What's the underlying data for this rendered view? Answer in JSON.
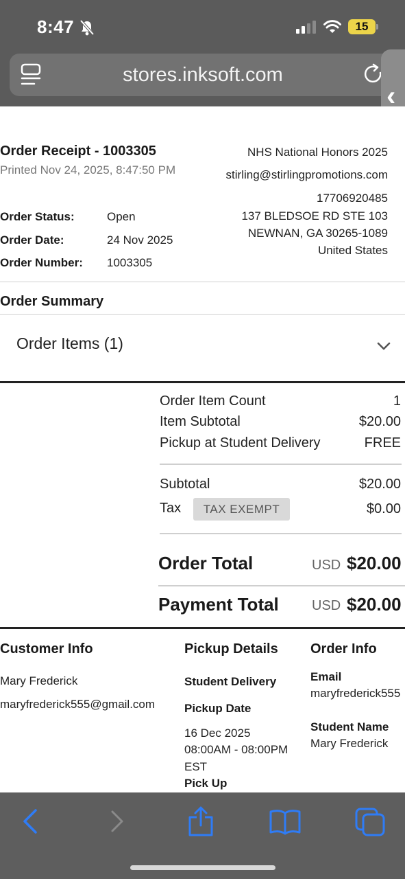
{
  "status_bar": {
    "time": "8:47",
    "battery": "15"
  },
  "browser": {
    "url": "stores.inksoft.com"
  },
  "receipt": {
    "title": "Order Receipt - 1003305",
    "printed": "Printed Nov 24, 2025, 8:47:50 PM",
    "store": {
      "name": "NHS National Honors 2025",
      "email": "stirling@stirlingpromotions.com",
      "phone": "17706920485",
      "address1": "137 BLEDSOE RD STE 103",
      "address2": "NEWNAN, GA 30265-1089",
      "country": "United States"
    },
    "fields": [
      {
        "label": "Order Status:",
        "value": "Open"
      },
      {
        "label": "Order Date:",
        "value": "24 Nov 2025"
      },
      {
        "label": "Order Number:",
        "value": "1003305"
      }
    ]
  },
  "summary": {
    "title": "Order Summary",
    "items_label": "Order Items (1)",
    "rows": [
      {
        "label": "Order Item Count",
        "value": "1"
      },
      {
        "label": "Item Subtotal",
        "value": "$20.00"
      },
      {
        "label": "Pickup at Student Delivery",
        "value": "FREE"
      }
    ],
    "subtotal_label": "Subtotal",
    "subtotal_value": "$20.00",
    "tax_label": "Tax",
    "tax_badge": "TAX EXEMPT",
    "tax_value": "$0.00",
    "order_total_label": "Order Total",
    "order_total_currency": "USD",
    "order_total_value": "$20.00",
    "payment_total_label": "Payment Total",
    "payment_total_currency": "USD",
    "payment_total_value": "$20.00"
  },
  "details": {
    "customer": {
      "title": "Customer Info",
      "name": "Mary Frederick",
      "email": "maryfrederick555@gmail.com"
    },
    "pickup": {
      "title": "Pickup Details",
      "method": "Student Delivery",
      "date_label": "Pickup Date",
      "date": "16 Dec 2025",
      "time": "08:00AM - 08:00PM",
      "tz": "EST",
      "pickup_label": "Pick Up"
    },
    "order_info": {
      "title": "Order Info",
      "email_label": "Email",
      "email": "maryfrederick555",
      "student_label": "Student Name",
      "student": "Mary Frederick"
    }
  },
  "colors": {
    "accent_blue": "#2f7cf6",
    "chrome_gray": "#5b5b5b",
    "battery_yellow": "#ecd44a"
  }
}
